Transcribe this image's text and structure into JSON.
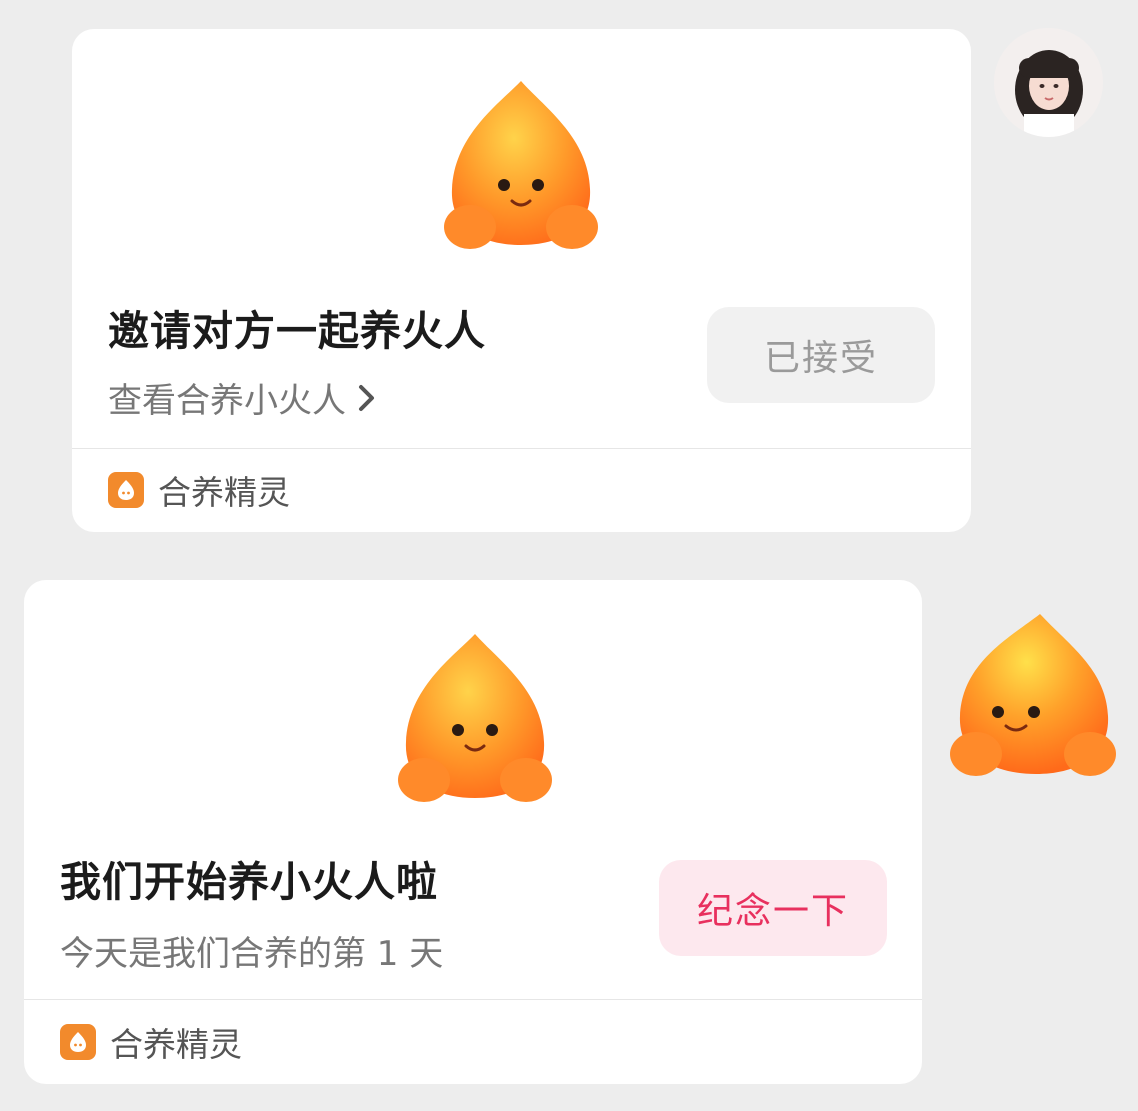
{
  "messages": [
    {
      "title": "邀请对方一起养火人",
      "subtitle": "查看合养小火人",
      "button_label": "已接受",
      "footer_app_name": "合养精灵",
      "mascot": "fire-mascot"
    },
    {
      "title": "我们开始养小火人啦",
      "subtitle": "今天是我们合养的第 1 天",
      "button_label": "纪念一下",
      "footer_app_name": "合养精灵",
      "mascot": "fire-mascot"
    }
  ],
  "colors": {
    "background": "#ededed",
    "card": "#ffffff",
    "accepted_button_bg": "#f1f1f1",
    "accepted_button_text": "#9a9a9a",
    "commemorate_button_bg": "#fde8ee",
    "commemorate_button_text": "#e8305e",
    "app_icon": "#f28a2c"
  },
  "icons": [
    "fire-mascot",
    "chevron-right-icon",
    "app-icon",
    "avatar",
    "fire-mascot-sticker"
  ]
}
